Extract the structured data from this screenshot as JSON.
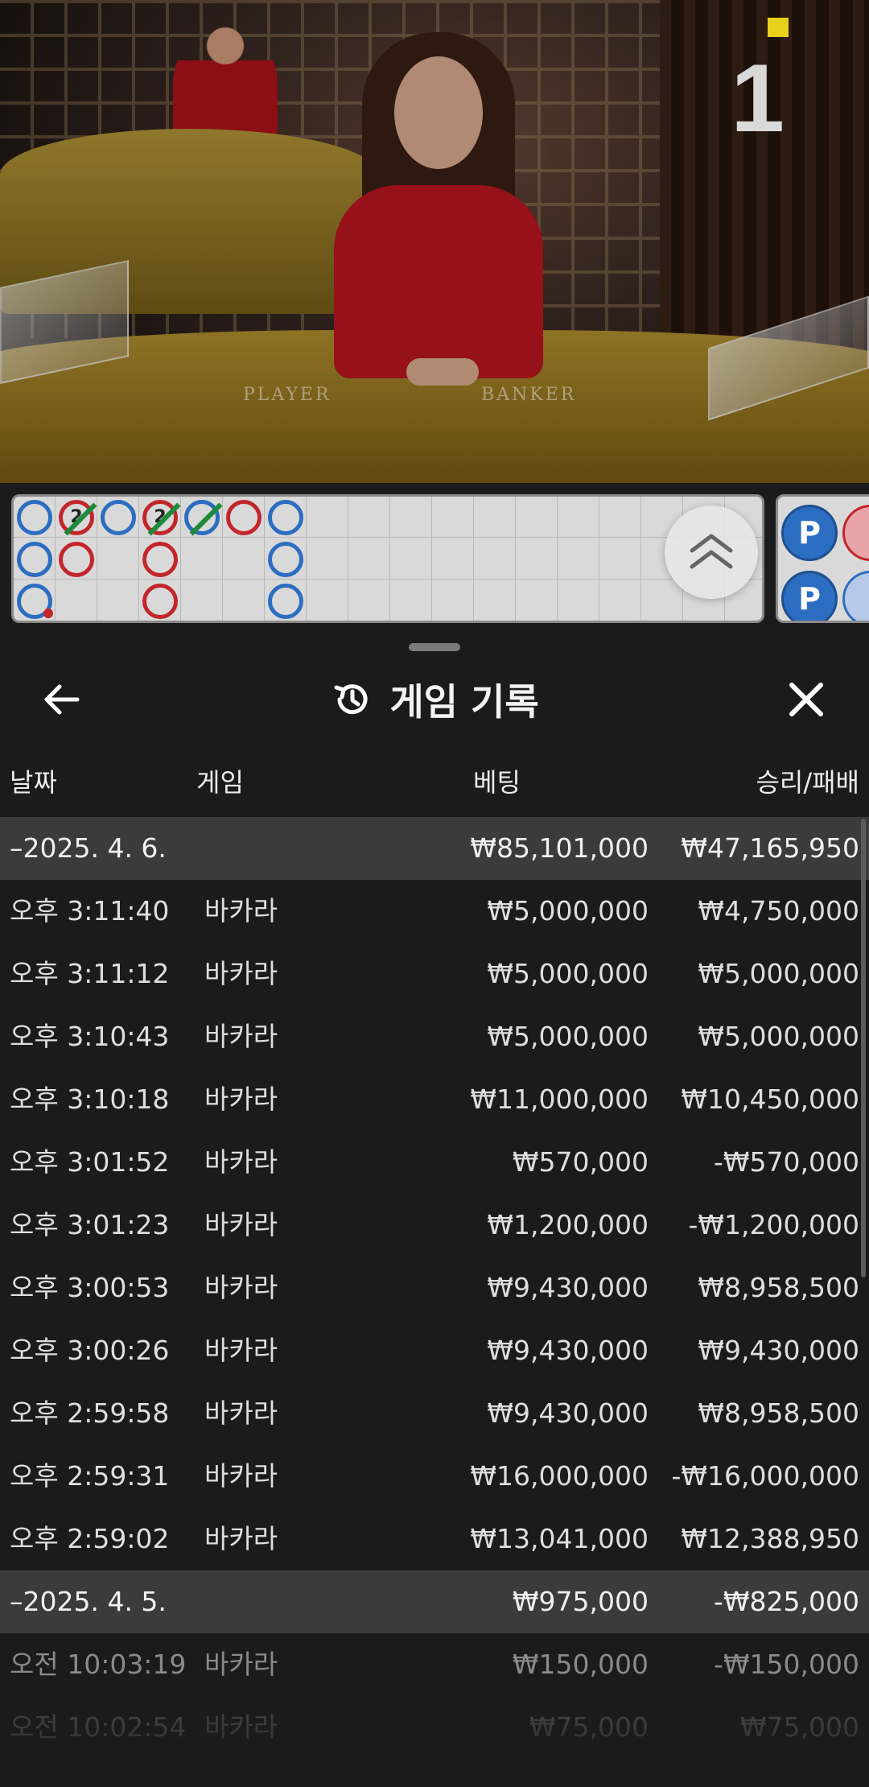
{
  "video": {
    "table_number": "1",
    "table_label_player": "PLAYER",
    "table_label_banker": "BANKER"
  },
  "roadmap": {
    "bead_numbers": [
      "2",
      "2"
    ],
    "big_road_labels": [
      "P",
      "P"
    ]
  },
  "history": {
    "title": "게임 기록",
    "icons": {
      "back": "arrow-left-icon",
      "history": "history-clock-icon",
      "close": "close-icon",
      "scroll_up": "chevron-double-up-icon"
    },
    "columns": {
      "date": "날짜",
      "game": "게임",
      "bet": "베팅",
      "win_loss": "승리/패배"
    },
    "groups": [
      {
        "date": "–2025. 4. 6.",
        "bet_total": "₩85,101,000",
        "win_total": "₩47,165,950",
        "rows": [
          {
            "time": "오후 3:11:40",
            "game": "바카라",
            "bet": "₩5,000,000",
            "win": "₩4,750,000"
          },
          {
            "time": "오후 3:11:12",
            "game": "바카라",
            "bet": "₩5,000,000",
            "win": "₩5,000,000"
          },
          {
            "time": "오후 3:10:43",
            "game": "바카라",
            "bet": "₩5,000,000",
            "win": "₩5,000,000"
          },
          {
            "time": "오후 3:10:18",
            "game": "바카라",
            "bet": "₩11,000,000",
            "win": "₩10,450,000"
          },
          {
            "time": "오후 3:01:52",
            "game": "바카라",
            "bet": "₩570,000",
            "win": "-₩570,000"
          },
          {
            "time": "오후 3:01:23",
            "game": "바카라",
            "bet": "₩1,200,000",
            "win": "-₩1,200,000"
          },
          {
            "time": "오후 3:00:53",
            "game": "바카라",
            "bet": "₩9,430,000",
            "win": "₩8,958,500"
          },
          {
            "time": "오후 3:00:26",
            "game": "바카라",
            "bet": "₩9,430,000",
            "win": "₩9,430,000"
          },
          {
            "time": "오후 2:59:58",
            "game": "바카라",
            "bet": "₩9,430,000",
            "win": "₩8,958,500"
          },
          {
            "time": "오후 2:59:31",
            "game": "바카라",
            "bet": "₩16,000,000",
            "win": "-₩16,000,000"
          },
          {
            "time": "오후 2:59:02",
            "game": "바카라",
            "bet": "₩13,041,000",
            "win": "₩12,388,950"
          }
        ]
      },
      {
        "date": "–2025. 4. 5.",
        "bet_total": "₩975,000",
        "win_total": "-₩825,000",
        "rows": [
          {
            "time": "오전 10:03:19",
            "game": "바카라",
            "bet": "₩150,000",
            "win": "-₩150,000"
          },
          {
            "time": "오전 10:02:54",
            "game": "바카라",
            "bet": "₩75,000",
            "win": "₩75,000"
          }
        ]
      }
    ]
  }
}
